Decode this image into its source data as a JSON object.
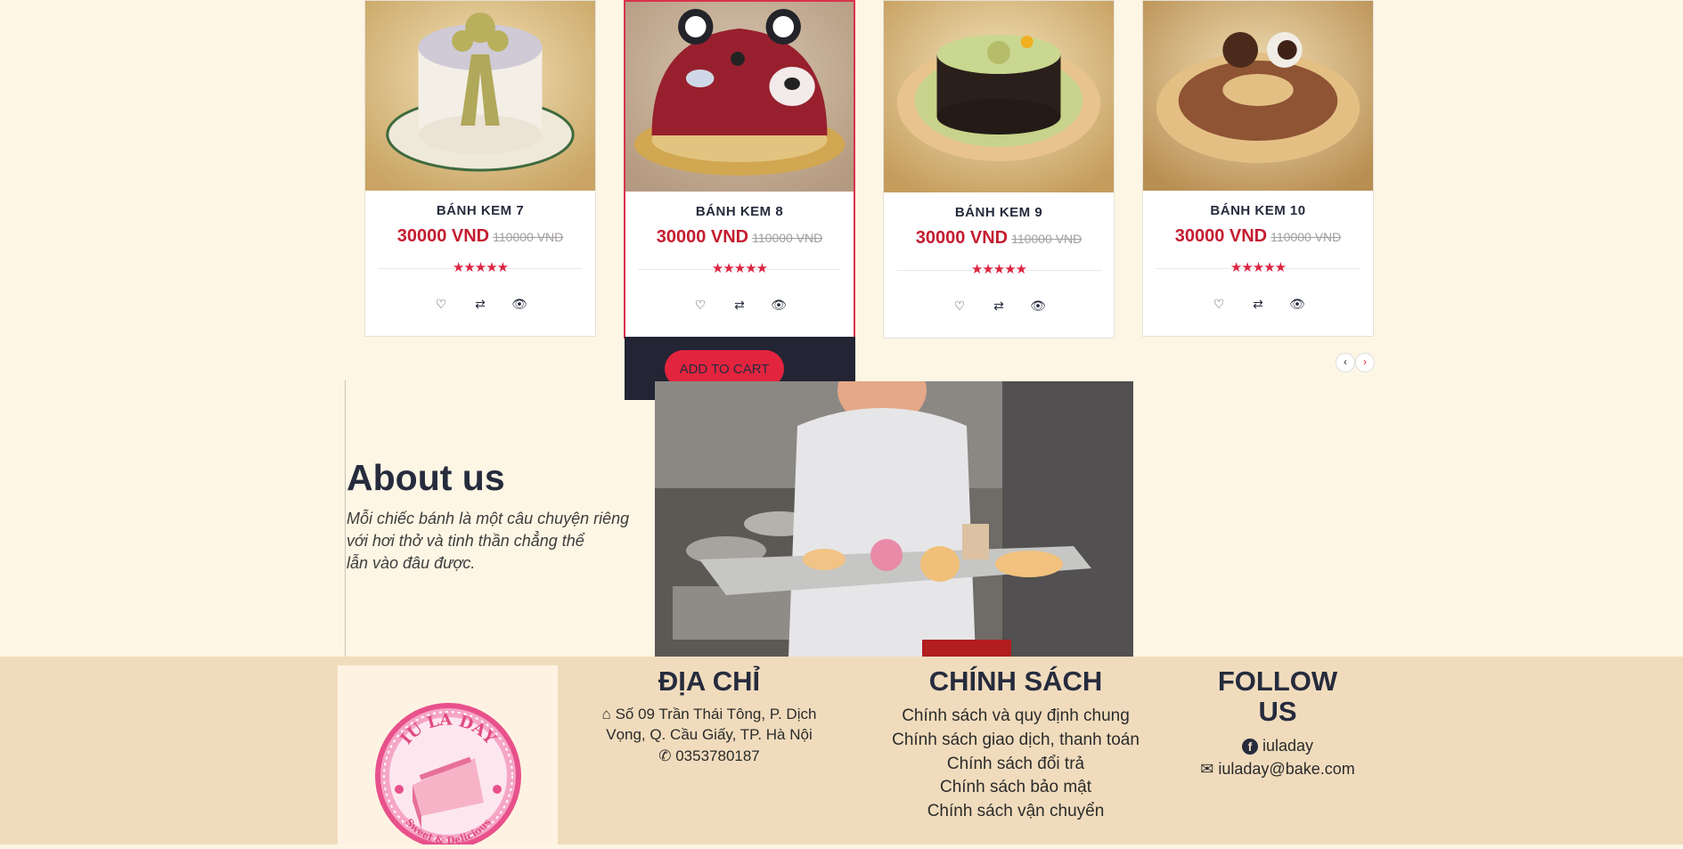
{
  "products": [
    {
      "name": "BÁNH KEM 7",
      "price": "30000 VND",
      "old_price": "110000 VND",
      "stars": "★★★★★"
    },
    {
      "name": "BÁNH KEM 8",
      "price": "30000 VND",
      "old_price": "110000 VND",
      "stars": "★★★★★"
    },
    {
      "name": "BÁNH KEM 9",
      "price": "30000 VND",
      "old_price": "110000 VND",
      "stars": "★★★★★"
    },
    {
      "name": "BÁNH KEM 10",
      "price": "30000 VND",
      "old_price": "110000 VND",
      "stars": "★★★★★"
    }
  ],
  "actions": {
    "wishlist": "♡",
    "compare": "⇄",
    "view": "👁"
  },
  "cart": {
    "label": "ADD TO CART"
  },
  "pager": {
    "prev": "‹",
    "next": "›"
  },
  "about": {
    "title": "About us",
    "lines": [
      "Mỗi chiếc bánh là một câu chuyện riêng",
      "với hơi thở và tinh thần chẳng thể",
      "lẫn vào đâu được."
    ]
  },
  "logo": {
    "top_text": "IU LA DAY",
    "bottom_text": "Sweet & Delicious"
  },
  "footer": {
    "address": {
      "heading": "ĐỊA CHỈ",
      "line1": "Số 09 Trần Thái Tông, P. Dịch",
      "line2": "Vọng, Q. Cầu Giấy, TP. Hà Nội",
      "phone": "0353780187",
      "home_icon": "⌂",
      "phone_icon": "✆"
    },
    "policy": {
      "heading": "CHÍNH SÁCH",
      "items": [
        "Chính sách và quy định chung",
        "Chính sách giao dịch, thanh toán",
        "Chính sách đổi trả",
        "Chính sách bảo mật",
        "Chính sách vận chuyển"
      ]
    },
    "follow": {
      "heading_line1": "FOLLOW",
      "heading_line2": "US",
      "facebook": "iuladay",
      "email": "iuladay@bake.com",
      "facebook_icon": "f",
      "mail_icon": "✉"
    }
  },
  "colors": {
    "accent": "#e3243e",
    "price": "#c41d30",
    "dark": "#262b3d",
    "page_bg": "#fdf6e4",
    "footer_bg": "#f0dcbd"
  }
}
